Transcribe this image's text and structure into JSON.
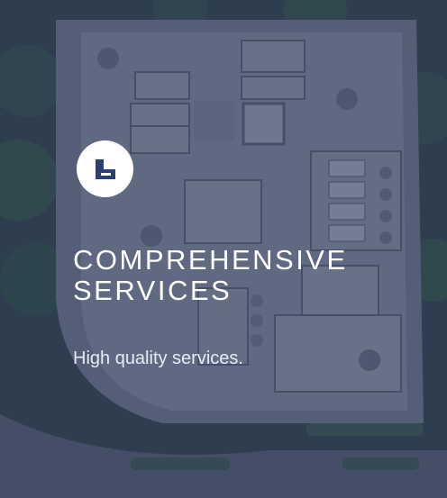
{
  "card": {
    "title": "COMPREHENSIVE SERVICES",
    "subtitle": "High quality services.",
    "icon": "building-plan-icon",
    "overlay_color": "#24345c",
    "accent_color": "#2c3f6e"
  }
}
